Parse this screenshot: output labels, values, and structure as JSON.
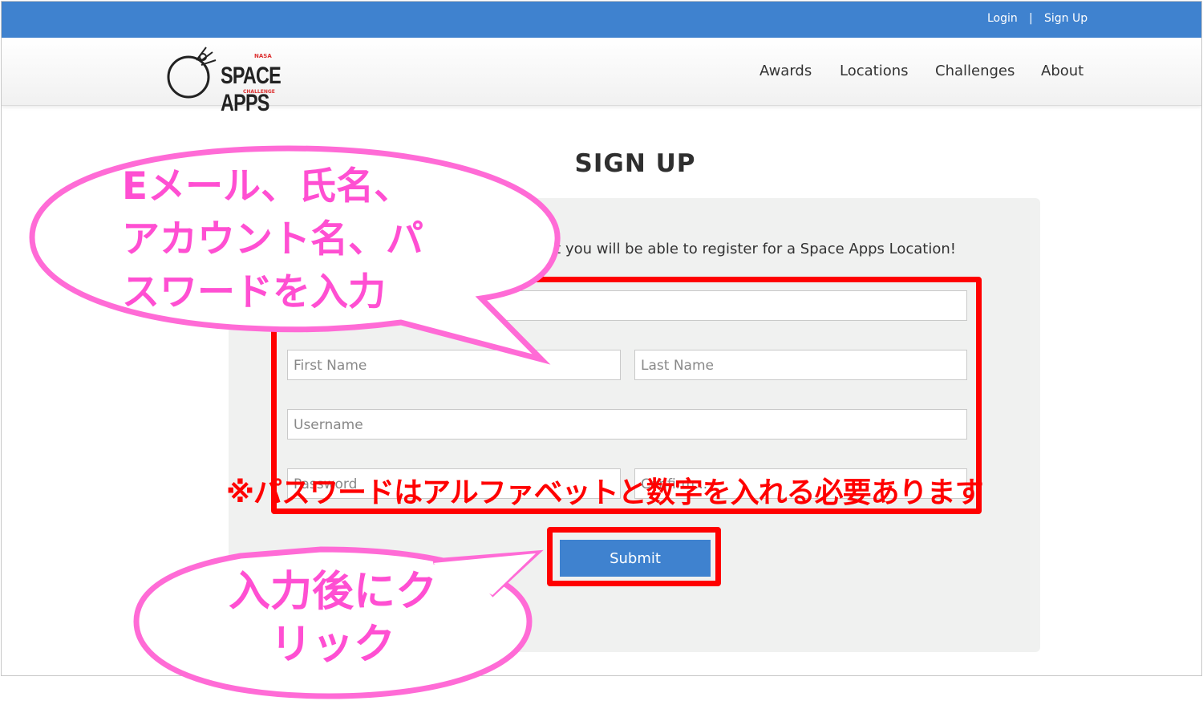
{
  "topbar": {
    "login": "Login",
    "separator": "|",
    "signup": "Sign Up"
  },
  "logo": {
    "text": "SPACE APPS",
    "top": "NASA",
    "bottom": "CHALLENGE"
  },
  "nav": [
    "Awards",
    "Locations",
    "Challenges",
    "About"
  ],
  "page": {
    "title": "SIGN UP",
    "intro": "nt you will be able to register for a Space Apps Location!"
  },
  "form": {
    "email_placeholder": "",
    "first_name_placeholder": "First Name",
    "last_name_placeholder": "Last Name",
    "username_placeholder": "Username",
    "password_placeholder": "Password",
    "confirm_placeholder": "Confirm...",
    "submit_label": "Submit"
  },
  "annotations": {
    "bubble1_lines": [
      "Eメール、氏名、",
      "アカウント名、パ",
      "スワードを入力"
    ],
    "note": "※パスワードはアルファベットと数字を入れる必要あります",
    "bubble2_lines": [
      "入力後にク",
      "リック"
    ]
  },
  "colors": {
    "topbar": "#3f82cf",
    "highlight": "#ff0000",
    "bubble": "#ff4fd2",
    "submit": "#3f82cf"
  }
}
